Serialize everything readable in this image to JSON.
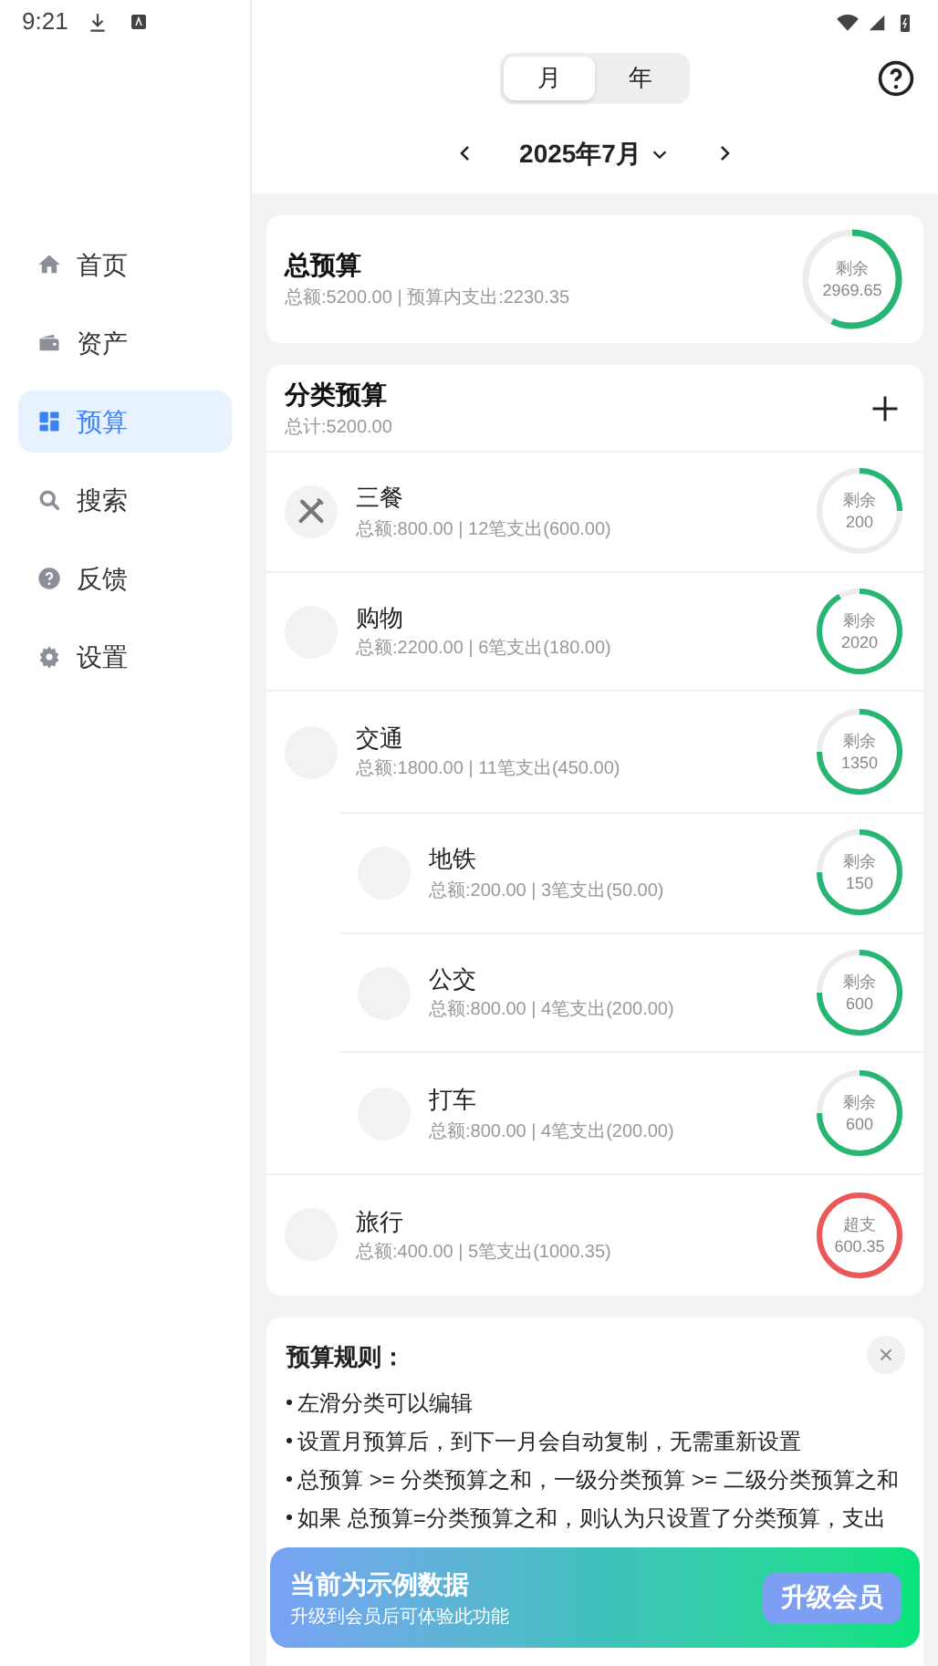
{
  "status_bar": {
    "time": "9:21"
  },
  "sidebar": {
    "items": [
      {
        "label": "首页",
        "selected": false
      },
      {
        "label": "资产",
        "selected": false
      },
      {
        "label": "预算",
        "selected": true
      },
      {
        "label": "搜索",
        "selected": false
      },
      {
        "label": "反馈",
        "selected": false
      },
      {
        "label": "设置",
        "selected": false
      }
    ]
  },
  "period_tabs": [
    {
      "label": "月",
      "selected": true
    },
    {
      "label": "年",
      "selected": false
    }
  ],
  "month_picker": {
    "label": "2025年7月"
  },
  "total_budget": {
    "title": "总预算",
    "summary": "总额:5200.00 | 预算内支出:2230.35",
    "ring": {
      "kind": "remaining",
      "label": "剩余",
      "value": "2969.65"
    }
  },
  "category_budget": {
    "title": "分类预算",
    "summary": "总计:5200.00",
    "items": [
      {
        "name": "三餐",
        "kind": "with_icon",
        "summary": "总额:800.00 | 12笔支出(600.00)",
        "ring": {
          "kind": "remaining",
          "label": "剩余",
          "value": "200"
        }
      },
      {
        "name": "购物",
        "summary": "总额:2200.00 | 6笔支出(180.00)",
        "ring": {
          "kind": "remaining",
          "label": "剩余",
          "value": "2020"
        }
      },
      {
        "name": "交通",
        "summary": "总额:1800.00 | 11笔支出(450.00)",
        "ring": {
          "kind": "remaining",
          "label": "剩余",
          "value": "1350"
        },
        "children": [
          {
            "name": "地铁",
            "summary": "总额:200.00 | 3笔支出(50.00)",
            "ring": {
              "kind": "remaining",
              "label": "剩余",
              "value": "150"
            }
          },
          {
            "name": "公交",
            "summary": "总额:800.00 | 4笔支出(200.00)",
            "ring": {
              "kind": "remaining",
              "label": "剩余",
              "value": "600"
            }
          },
          {
            "name": "打车",
            "summary": "总额:800.00 | 4笔支出(200.00)",
            "ring": {
              "kind": "remaining",
              "label": "剩余",
              "value": "600"
            }
          }
        ]
      },
      {
        "name": "旅行",
        "summary": "总额:400.00 | 5笔支出(1000.35)",
        "ring": {
          "kind": "over",
          "label": "超支",
          "value": "600.35"
        }
      }
    ]
  },
  "rules": {
    "title": "预算规则：",
    "items": [
      "左滑分类可以编辑",
      "设置月预算后，到下一月会自动复制，无需重新设置",
      "总预算 >= 分类预算之和，一级分类预算 >= 二级分类预算之和",
      "如果 总预算=分类预算之和，则认为只设置了分类预算，支出"
    ]
  },
  "banner": {
    "title": "当前为示例数据",
    "subtitle": "升级到会员后可体验此功能",
    "button": "升级会员"
  }
}
